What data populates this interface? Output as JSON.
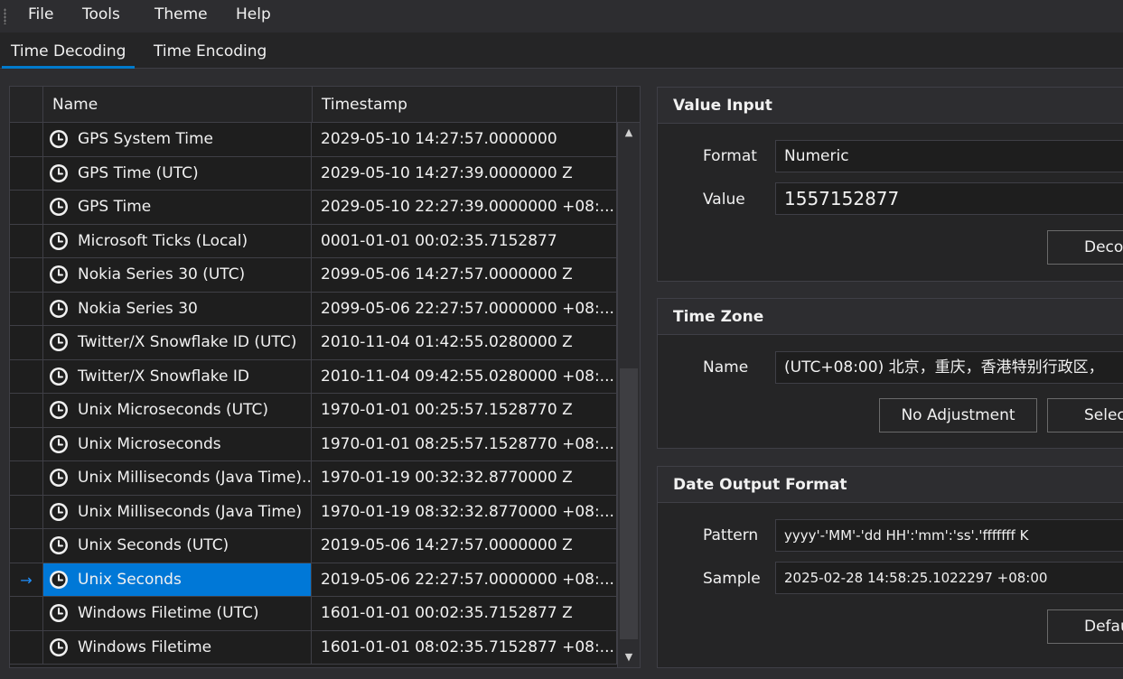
{
  "menu": {
    "items": [
      "File",
      "Tools",
      "Theme",
      "Help"
    ]
  },
  "tabs": [
    "Time Decoding",
    "Time Encoding"
  ],
  "grid": {
    "columns": [
      "Name",
      "Timestamp"
    ],
    "rows": [
      {
        "name": "GPS System Time",
        "timestamp": "2029-05-10 14:27:57.0000000"
      },
      {
        "name": "GPS Time (UTC)",
        "timestamp": "2029-05-10 14:27:39.0000000 Z"
      },
      {
        "name": "GPS Time",
        "timestamp": "2029-05-10 22:27:39.0000000 +08:..."
      },
      {
        "name": "Microsoft Ticks (Local)",
        "timestamp": "0001-01-01 00:02:35.7152877"
      },
      {
        "name": "Nokia Series 30 (UTC)",
        "timestamp": "2099-05-06 14:27:57.0000000 Z"
      },
      {
        "name": "Nokia Series 30",
        "timestamp": "2099-05-06 22:27:57.0000000 +08:..."
      },
      {
        "name": "Twitter/X Snowflake ID (UTC)",
        "timestamp": "2010-11-04 01:42:55.0280000 Z"
      },
      {
        "name": "Twitter/X Snowflake ID",
        "timestamp": "2010-11-04 09:42:55.0280000 +08:..."
      },
      {
        "name": "Unix Microseconds (UTC)",
        "timestamp": "1970-01-01 00:25:57.1528770 Z"
      },
      {
        "name": "Unix Microseconds",
        "timestamp": "1970-01-01 08:25:57.1528770 +08:..."
      },
      {
        "name": "Unix Milliseconds (Java Time)...",
        "timestamp": "1970-01-19 00:32:32.8770000 Z"
      },
      {
        "name": "Unix Milliseconds (Java Time)",
        "timestamp": "1970-01-19 08:32:32.8770000 +08:..."
      },
      {
        "name": "Unix Seconds (UTC)",
        "timestamp": "2019-05-06 14:27:57.0000000 Z"
      },
      {
        "name": "Unix Seconds",
        "timestamp": "2019-05-06 22:27:57.0000000 +08:...",
        "selected": true
      },
      {
        "name": "Windows Filetime (UTC)",
        "timestamp": "1601-01-01 00:02:35.7152877 Z"
      },
      {
        "name": "Windows Filetime",
        "timestamp": "1601-01-01 08:02:35.7152877 +08:..."
      }
    ]
  },
  "value_input": {
    "title": "Value Input",
    "format_label": "Format",
    "format_value": "Numeric",
    "value_label": "Value",
    "value": "1557152877",
    "decode_button": "Deco"
  },
  "time_zone": {
    "title": "Time Zone",
    "name_label": "Name",
    "name_value": "(UTC+08:00) 北京，重庆，香港特别行政区，",
    "no_adjustment_button": "No Adjustment",
    "select_button": "Selec"
  },
  "date_output": {
    "title": "Date Output Format",
    "pattern_label": "Pattern",
    "pattern_value": "yyyy'-'MM'-'dd HH':'mm':'ss'.'fffffff K",
    "sample_label": "Sample",
    "sample_value": "2025-02-28 14:58:25.1022297 +08:00",
    "default_button": "Defau"
  },
  "colors": {
    "accent": "#007acc",
    "selection": "#0078d7",
    "background": "#2d2d30"
  }
}
